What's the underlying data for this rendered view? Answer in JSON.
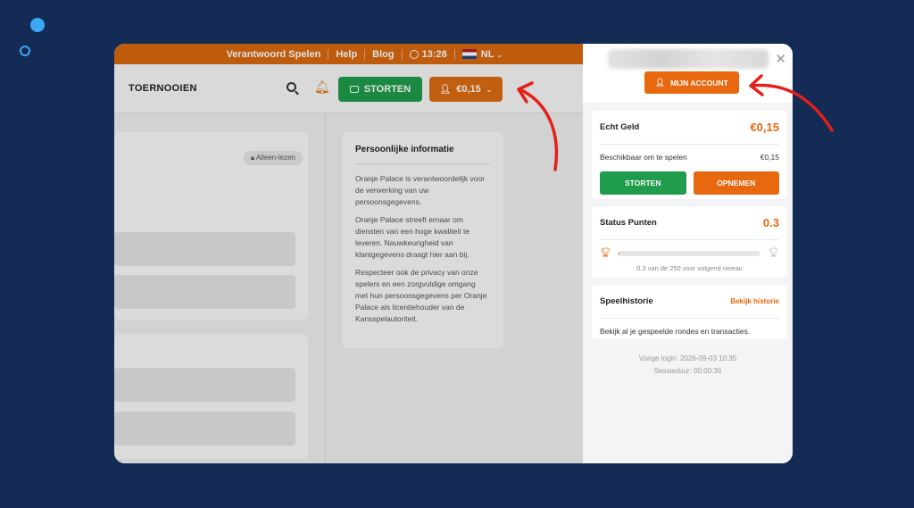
{
  "colors": {
    "background": "#132b55",
    "brand_orange": "#e8680f",
    "brand_green": "#1f9c4c",
    "annotation_red": "#e3201b"
  },
  "topbar": {
    "responsible": "Verantwoord Spelen",
    "help": "Help",
    "blog": "Blog",
    "time": "13:28",
    "language": "NL"
  },
  "navbar": {
    "title": "TOERNOOIEN",
    "deposit_label": "STORTEN",
    "balance": "€0,15"
  },
  "left_card": {
    "readonly_badge": "Alleen-lezen"
  },
  "info_card": {
    "title": "Persoonlijke informatie",
    "paragraphs": [
      "Oranje Palace is verantwoordelijk voor de verwerking van uw persoonsgegevens.",
      "Oranje Palace streeft ernaar om diensten van een hoge kwaliteit te leveren. Nauwkeurigheid van klantgegevens draagt hier aan bij.",
      "Respecteer ook de privacy van onze spelers en een zorgvuldige omgang met hun persoonsgegevens per Oranje Palace als licentiehouder van de Kansspelautoriteit."
    ]
  },
  "panel": {
    "account_button": "MIJN ACCOUNT",
    "real_money": {
      "label": "Echt Geld",
      "value": "€0,15",
      "available_label": "Beschikbaar om te spelen",
      "available_value": "€0,15",
      "deposit_button": "STORTEN",
      "withdraw_button": "OPNEMEN"
    },
    "status_points": {
      "label": "Status Punten",
      "value": "0.3",
      "progress_fraction": 0.0012,
      "caption": "0.3 van de 250 voor volgend niveau"
    },
    "history": {
      "label": "Speelhistorie",
      "link": "Bekijk historie",
      "description": "Bekijk al je gespeelde rondes en transacties."
    },
    "last_login": "Vorige login: 2026-09-03 10:35",
    "session_duration": "Sessieduur: 00:00:36"
  }
}
